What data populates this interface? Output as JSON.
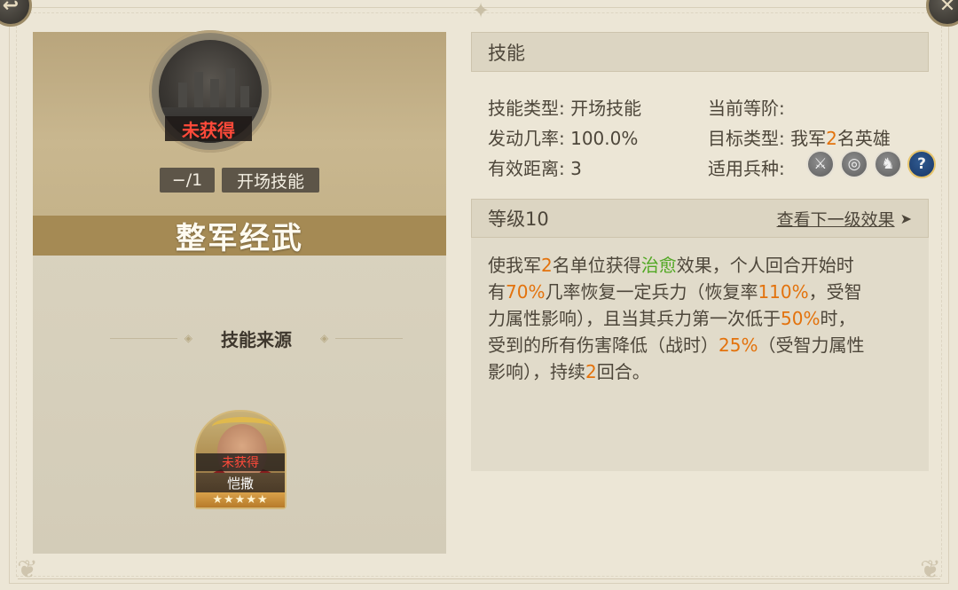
{
  "skill": {
    "name": "整军经武",
    "status": "未获得",
    "level_chip": "−/1",
    "type_chip": "开场技能"
  },
  "source": {
    "title": "技能来源",
    "hero": {
      "status": "未获得",
      "name": "恺撒",
      "stars": "★★★★★"
    }
  },
  "panel": {
    "header": "技能",
    "skill_type_label": "技能类型:",
    "skill_type_value": "开场技能",
    "trigger_label": "发动几率:",
    "trigger_value": "100.0%",
    "range_label": "有效距离:",
    "range_value": "3",
    "rank_label": "当前等阶:",
    "rank_value": "",
    "target_label": "目标类型:",
    "target_prefix": "我军",
    "target_number": "2",
    "target_suffix": "名英雄",
    "troop_label": "适用兵种:",
    "troop_icons": [
      "sword-icon",
      "target-icon",
      "horse-icon",
      "question-icon"
    ]
  },
  "level": {
    "label": "等级10",
    "next_link": "查看下一级效果",
    "arrow": "➤"
  },
  "description": {
    "l1_a": "使我军",
    "l1_b": "2",
    "l1_c": "名单位获得",
    "l1_d": "治愈",
    "l1_e": "效果，个人回合开始时",
    "l2_a": "有",
    "l2_b": "70%",
    "l2_c": "几率恢复一定兵力（恢复率",
    "l2_d": "110%",
    "l2_e": "，受智",
    "l3_a": "力属性影响），且当其兵力第一次低于",
    "l3_b": "50%",
    "l3_c": "时，",
    "l4_a": "受到的所有伤害降低（战时）",
    "l4_b": "25%",
    "l4_c": "（受智力属性",
    "l5_a": "影响），持续",
    "l5_b": "2",
    "l5_c": "回合。"
  },
  "colors": {
    "highlight_orange": "#e3720c",
    "highlight_green": "#52a824",
    "unobtained_red": "#ff4a3a",
    "title_bar_brown": "#a58a54"
  }
}
